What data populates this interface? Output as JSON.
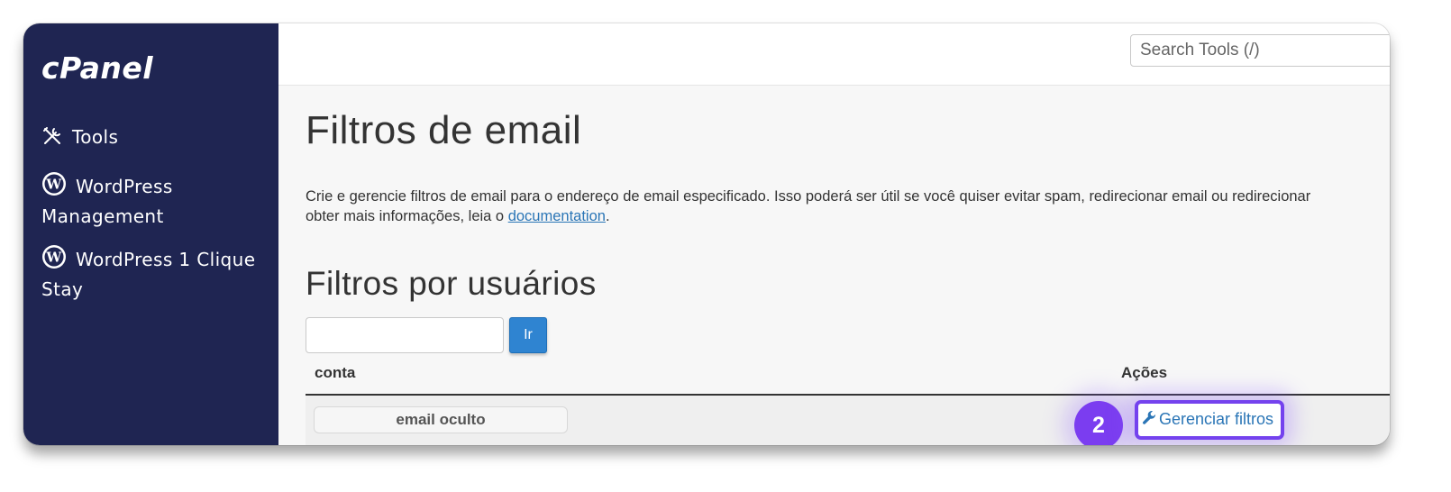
{
  "sidebar": {
    "logo": "cPanel",
    "items": [
      {
        "label": "Tools",
        "icon": "tools-icon"
      },
      {
        "label": "WordPress Management",
        "icon": "wordpress-icon"
      },
      {
        "label": "WordPress 1 Clique Stay",
        "icon": "wordpress-icon"
      }
    ]
  },
  "header": {
    "search_placeholder": "Search Tools (/)"
  },
  "main": {
    "title": "Filtros de email",
    "description_line1": "Crie e gerencie filtros de email para o endereço de email especificado. Isso poderá ser útil se você quiser evitar spam, redirecionar email ou redirecionar",
    "description_line2_prefix": "obter mais informações, leia o ",
    "documentation_link": "documentation",
    "description_line2_suffix": ".",
    "section_title": "Filtros por usuários",
    "go_button": "Ir",
    "table": {
      "columns": [
        "conta",
        "Ações"
      ],
      "rows": [
        {
          "account": "email oculto",
          "action": "Gerenciar filtros"
        }
      ]
    },
    "step_badge": "2"
  },
  "colors": {
    "sidebar_bg": "#1f2552",
    "accent": "#2f84d1",
    "highlight": "#7442ee"
  }
}
